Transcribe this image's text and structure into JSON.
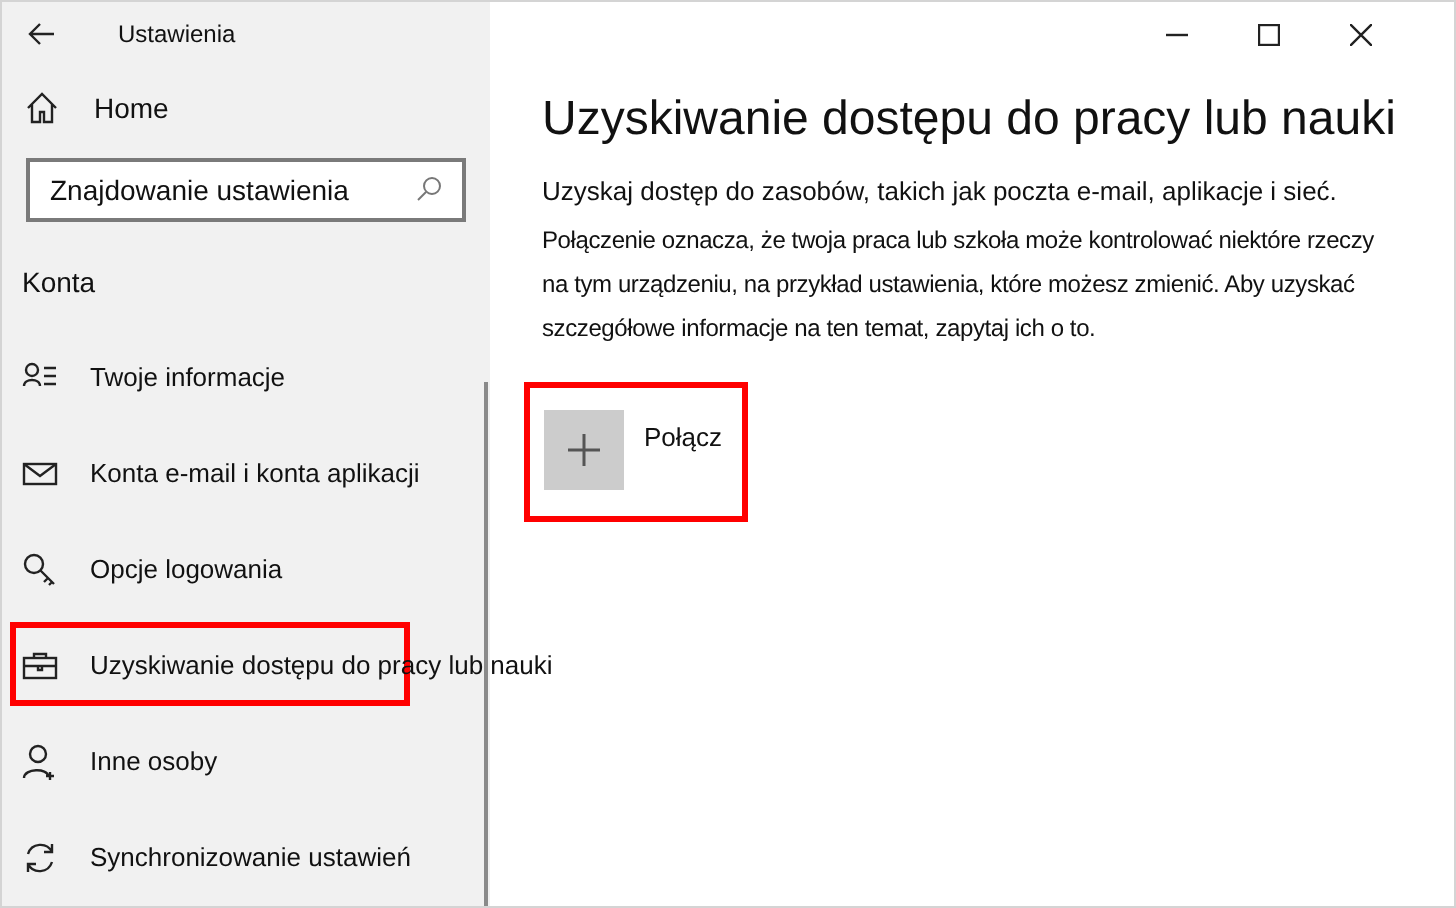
{
  "window": {
    "title": "Ustawienia"
  },
  "sidebar": {
    "home": "Home",
    "search": {
      "placeholder": "Znajdowanie ustawienia"
    },
    "section": "Konta",
    "items": [
      {
        "kind": "person-list",
        "label": "Twoje informacje",
        "highlighted": false
      },
      {
        "kind": "mail",
        "label": "Konta e-mail i konta aplikacji",
        "highlighted": false
      },
      {
        "kind": "key",
        "label": "Opcje logowania",
        "highlighted": false
      },
      {
        "kind": "briefcase",
        "label": "Uzyskiwanie dostępu do pracy lub nauki",
        "highlighted": true
      },
      {
        "kind": "person-add",
        "label": "Inne osoby",
        "highlighted": false
      },
      {
        "kind": "sync",
        "label": "Synchronizowanie ustawień",
        "highlighted": false
      }
    ]
  },
  "content": {
    "title": "Uzyskiwanie dostępu do pracy lub nauki",
    "intro": "Uzyskaj dostęp do zasobów, takich jak poczta e-mail, aplikacje i sieć.",
    "description": "Połączenie oznacza, że twoja praca lub szkoła może kontrolować niektóre rzeczy na tym urządzeniu, na przykład ustawienia, które możesz zmienić. Aby uzyskać szczegółowe informacje na ten temat, zapytaj ich o to.",
    "connect": {
      "label": "Połącz",
      "highlighted": true
    }
  }
}
